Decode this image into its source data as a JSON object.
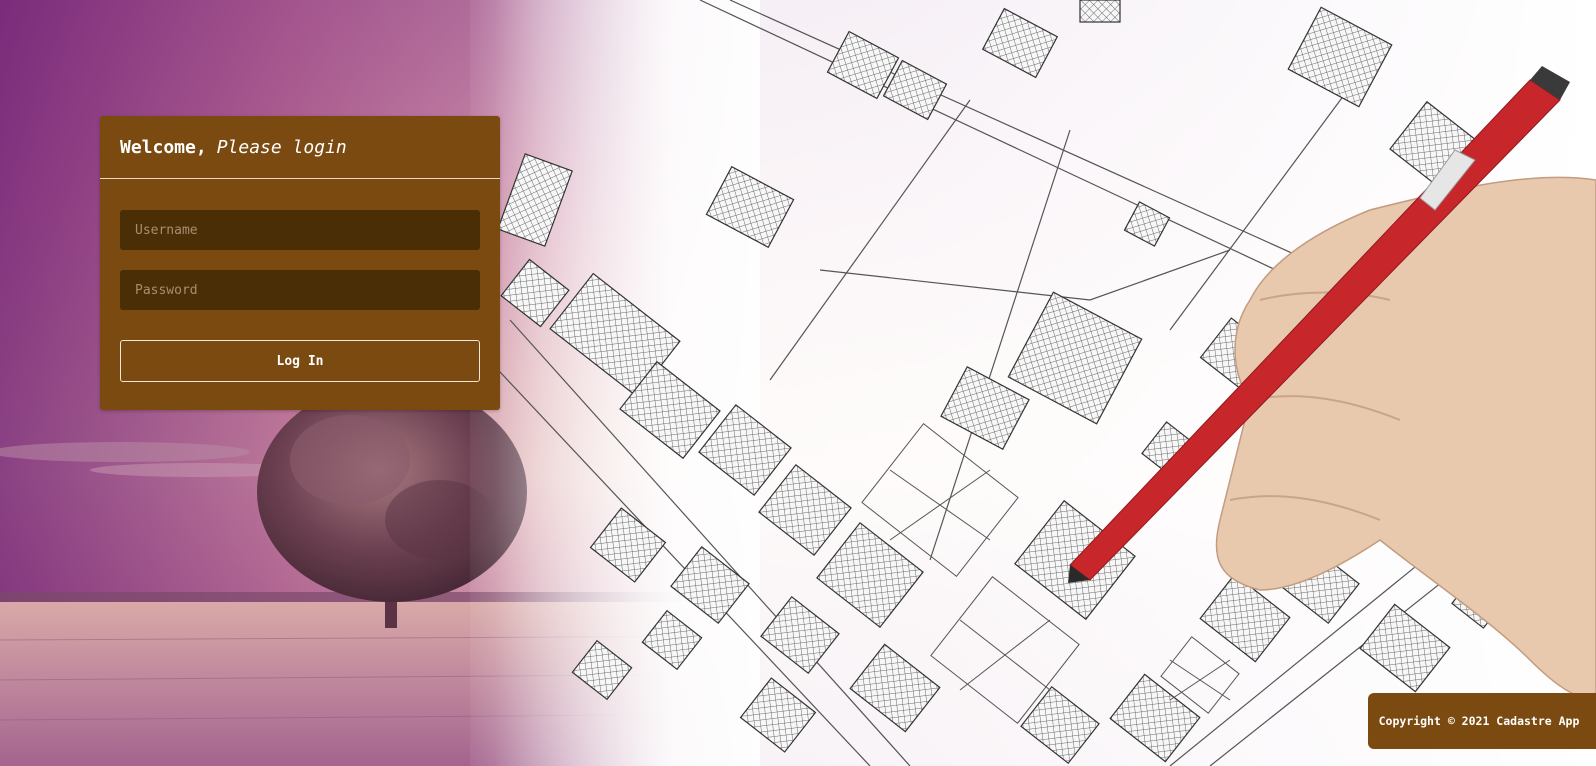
{
  "login": {
    "title_bold": "Welcome,",
    "title_italic": "Please login",
    "username_placeholder": "Username",
    "password_placeholder": "Password",
    "submit_label": "Log In"
  },
  "footer": {
    "copyright": "Copyright © 2021 Cadastre App"
  },
  "colors": {
    "panel_brown": "#7a4a10",
    "input_dark_brown": "#4a2e05",
    "background_purple": "#8a3e8c"
  },
  "background": {
    "description_icons": [
      "landscape-tree-image",
      "cadastral-map-sketch",
      "hand-with-red-pencil"
    ]
  }
}
